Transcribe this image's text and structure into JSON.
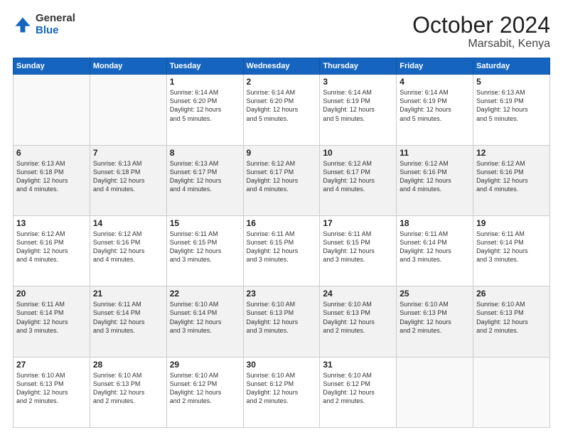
{
  "header": {
    "logo_general": "General",
    "logo_blue": "Blue",
    "title": "October 2024",
    "location": "Marsabit, Kenya"
  },
  "days_of_week": [
    "Sunday",
    "Monday",
    "Tuesday",
    "Wednesday",
    "Thursday",
    "Friday",
    "Saturday"
  ],
  "weeks": [
    [
      {
        "num": "",
        "detail": ""
      },
      {
        "num": "",
        "detail": ""
      },
      {
        "num": "1",
        "detail": "Sunrise: 6:14 AM\nSunset: 6:20 PM\nDaylight: 12 hours\nand 5 minutes."
      },
      {
        "num": "2",
        "detail": "Sunrise: 6:14 AM\nSunset: 6:20 PM\nDaylight: 12 hours\nand 5 minutes."
      },
      {
        "num": "3",
        "detail": "Sunrise: 6:14 AM\nSunset: 6:19 PM\nDaylight: 12 hours\nand 5 minutes."
      },
      {
        "num": "4",
        "detail": "Sunrise: 6:14 AM\nSunset: 6:19 PM\nDaylight: 12 hours\nand 5 minutes."
      },
      {
        "num": "5",
        "detail": "Sunrise: 6:13 AM\nSunset: 6:19 PM\nDaylight: 12 hours\nand 5 minutes."
      }
    ],
    [
      {
        "num": "6",
        "detail": "Sunrise: 6:13 AM\nSunset: 6:18 PM\nDaylight: 12 hours\nand 4 minutes."
      },
      {
        "num": "7",
        "detail": "Sunrise: 6:13 AM\nSunset: 6:18 PM\nDaylight: 12 hours\nand 4 minutes."
      },
      {
        "num": "8",
        "detail": "Sunrise: 6:13 AM\nSunset: 6:17 PM\nDaylight: 12 hours\nand 4 minutes."
      },
      {
        "num": "9",
        "detail": "Sunrise: 6:12 AM\nSunset: 6:17 PM\nDaylight: 12 hours\nand 4 minutes."
      },
      {
        "num": "10",
        "detail": "Sunrise: 6:12 AM\nSunset: 6:17 PM\nDaylight: 12 hours\nand 4 minutes."
      },
      {
        "num": "11",
        "detail": "Sunrise: 6:12 AM\nSunset: 6:16 PM\nDaylight: 12 hours\nand 4 minutes."
      },
      {
        "num": "12",
        "detail": "Sunrise: 6:12 AM\nSunset: 6:16 PM\nDaylight: 12 hours\nand 4 minutes."
      }
    ],
    [
      {
        "num": "13",
        "detail": "Sunrise: 6:12 AM\nSunset: 6:16 PM\nDaylight: 12 hours\nand 4 minutes."
      },
      {
        "num": "14",
        "detail": "Sunrise: 6:12 AM\nSunset: 6:16 PM\nDaylight: 12 hours\nand 4 minutes."
      },
      {
        "num": "15",
        "detail": "Sunrise: 6:11 AM\nSunset: 6:15 PM\nDaylight: 12 hours\nand 3 minutes."
      },
      {
        "num": "16",
        "detail": "Sunrise: 6:11 AM\nSunset: 6:15 PM\nDaylight: 12 hours\nand 3 minutes."
      },
      {
        "num": "17",
        "detail": "Sunrise: 6:11 AM\nSunset: 6:15 PM\nDaylight: 12 hours\nand 3 minutes."
      },
      {
        "num": "18",
        "detail": "Sunrise: 6:11 AM\nSunset: 6:14 PM\nDaylight: 12 hours\nand 3 minutes."
      },
      {
        "num": "19",
        "detail": "Sunrise: 6:11 AM\nSunset: 6:14 PM\nDaylight: 12 hours\nand 3 minutes."
      }
    ],
    [
      {
        "num": "20",
        "detail": "Sunrise: 6:11 AM\nSunset: 6:14 PM\nDaylight: 12 hours\nand 3 minutes."
      },
      {
        "num": "21",
        "detail": "Sunrise: 6:11 AM\nSunset: 6:14 PM\nDaylight: 12 hours\nand 3 minutes."
      },
      {
        "num": "22",
        "detail": "Sunrise: 6:10 AM\nSunset: 6:14 PM\nDaylight: 12 hours\nand 3 minutes."
      },
      {
        "num": "23",
        "detail": "Sunrise: 6:10 AM\nSunset: 6:13 PM\nDaylight: 12 hours\nand 3 minutes."
      },
      {
        "num": "24",
        "detail": "Sunrise: 6:10 AM\nSunset: 6:13 PM\nDaylight: 12 hours\nand 2 minutes."
      },
      {
        "num": "25",
        "detail": "Sunrise: 6:10 AM\nSunset: 6:13 PM\nDaylight: 12 hours\nand 2 minutes."
      },
      {
        "num": "26",
        "detail": "Sunrise: 6:10 AM\nSunset: 6:13 PM\nDaylight: 12 hours\nand 2 minutes."
      }
    ],
    [
      {
        "num": "27",
        "detail": "Sunrise: 6:10 AM\nSunset: 6:13 PM\nDaylight: 12 hours\nand 2 minutes."
      },
      {
        "num": "28",
        "detail": "Sunrise: 6:10 AM\nSunset: 6:13 PM\nDaylight: 12 hours\nand 2 minutes."
      },
      {
        "num": "29",
        "detail": "Sunrise: 6:10 AM\nSunset: 6:12 PM\nDaylight: 12 hours\nand 2 minutes."
      },
      {
        "num": "30",
        "detail": "Sunrise: 6:10 AM\nSunset: 6:12 PM\nDaylight: 12 hours\nand 2 minutes."
      },
      {
        "num": "31",
        "detail": "Sunrise: 6:10 AM\nSunset: 6:12 PM\nDaylight: 12 hours\nand 2 minutes."
      },
      {
        "num": "",
        "detail": ""
      },
      {
        "num": "",
        "detail": ""
      }
    ]
  ]
}
